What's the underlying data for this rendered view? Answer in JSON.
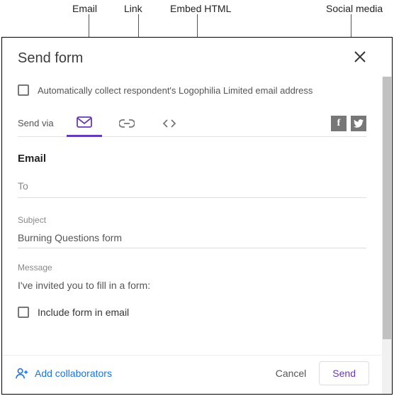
{
  "annotations": {
    "email": "Email",
    "link": "Link",
    "embed": "Embed HTML",
    "social": "Social media"
  },
  "dialog": {
    "title": "Send form",
    "auto_collect": "Automatically collect respondent's Logophilia Limited email address",
    "send_via_label": "Send via",
    "tabs": {
      "email": "email-icon",
      "link": "link-icon",
      "embed": "embed-icon"
    },
    "social": {
      "facebook": "facebook",
      "twitter": "twitter"
    },
    "section": "Email",
    "to_label": "To",
    "subject_label": "Subject",
    "subject_value": "Burning Questions form",
    "message_label": "Message",
    "message_value": "I've invited you to fill in a form:",
    "include_form": "Include form in email",
    "add_collaborators": "Add collaborators",
    "cancel": "Cancel",
    "send": "Send"
  }
}
